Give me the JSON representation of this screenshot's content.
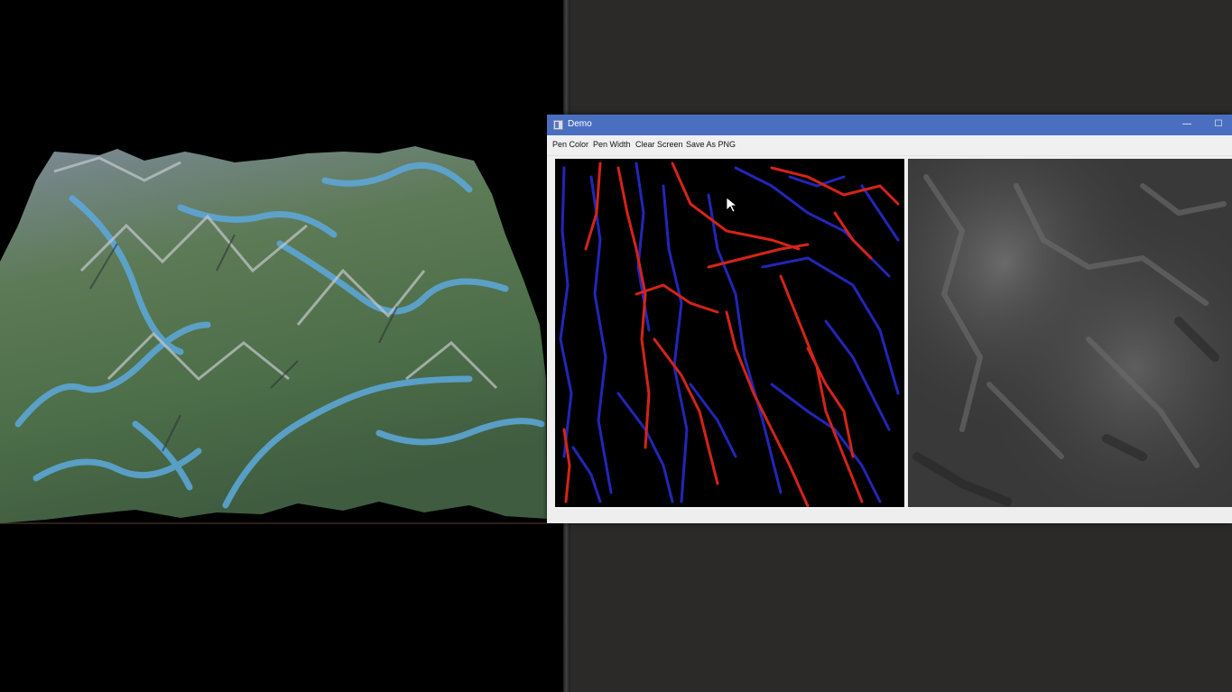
{
  "window": {
    "title": "Demo",
    "minimize_glyph": "—",
    "maximize_glyph": "☐"
  },
  "menu": [
    {
      "label": "Pen Color"
    },
    {
      "label": "Pen Width"
    },
    {
      "label": "Clear Screen"
    },
    {
      "label": "Save As PNG"
    }
  ],
  "colors": {
    "pen_red": "#d42418",
    "pen_blue": "#2226b8",
    "titlebar": "#4a6fc0"
  },
  "icons": [
    "app-icon",
    "minimize-icon",
    "maximize-icon",
    "mouse-cursor-icon"
  ]
}
